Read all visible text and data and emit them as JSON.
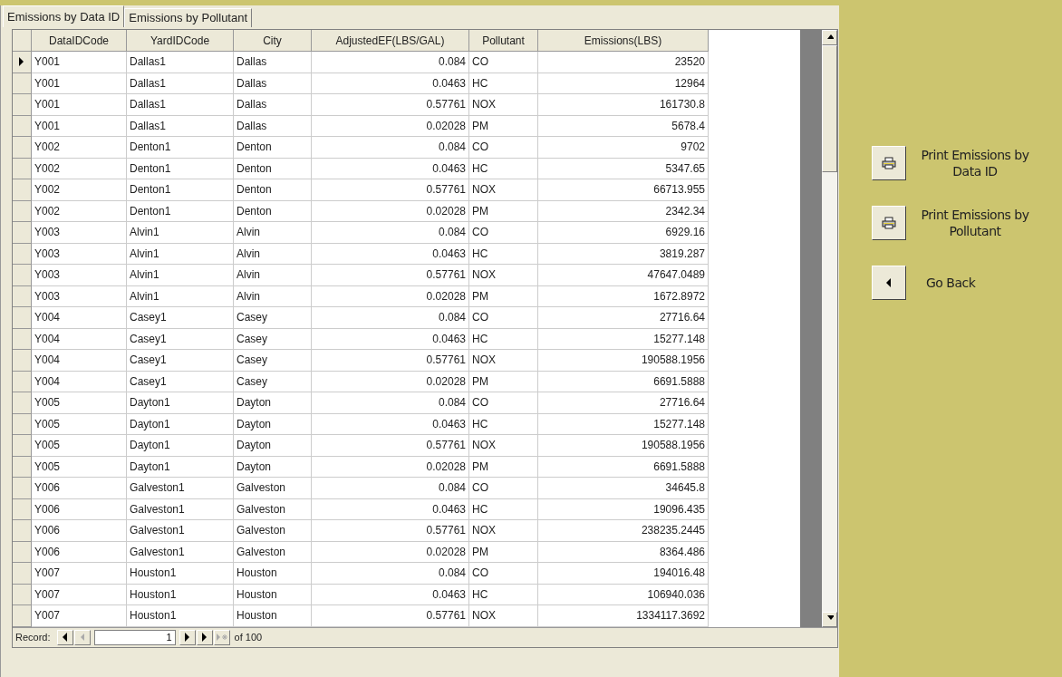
{
  "tabs": [
    {
      "label": "Emissions by Data ID",
      "selected": true
    },
    {
      "label": "Emissions by Pollutant",
      "selected": false
    }
  ],
  "table": {
    "columns": [
      "DataIDCode",
      "YardIDCode",
      "City",
      "AdjustedEF(LBS/GAL)",
      "Pollutant",
      "Emissions(LBS)"
    ],
    "rows": [
      {
        "current": true,
        "cells": [
          "Y001",
          "Dallas1",
          "Dallas",
          "0.084",
          "CO",
          "23520"
        ]
      },
      {
        "current": false,
        "cells": [
          "Y001",
          "Dallas1",
          "Dallas",
          "0.0463",
          "HC",
          "12964"
        ]
      },
      {
        "current": false,
        "cells": [
          "Y001",
          "Dallas1",
          "Dallas",
          "0.57761",
          "NOX",
          "161730.8"
        ]
      },
      {
        "current": false,
        "cells": [
          "Y001",
          "Dallas1",
          "Dallas",
          "0.02028",
          "PM",
          "5678.4"
        ]
      },
      {
        "current": false,
        "cells": [
          "Y002",
          "Denton1",
          "Denton",
          "0.084",
          "CO",
          "9702"
        ]
      },
      {
        "current": false,
        "cells": [
          "Y002",
          "Denton1",
          "Denton",
          "0.0463",
          "HC",
          "5347.65"
        ]
      },
      {
        "current": false,
        "cells": [
          "Y002",
          "Denton1",
          "Denton",
          "0.57761",
          "NOX",
          "66713.955"
        ]
      },
      {
        "current": false,
        "cells": [
          "Y002",
          "Denton1",
          "Denton",
          "0.02028",
          "PM",
          "2342.34"
        ]
      },
      {
        "current": false,
        "cells": [
          "Y003",
          "Alvin1",
          "Alvin",
          "0.084",
          "CO",
          "6929.16"
        ]
      },
      {
        "current": false,
        "cells": [
          "Y003",
          "Alvin1",
          "Alvin",
          "0.0463",
          "HC",
          "3819.287"
        ]
      },
      {
        "current": false,
        "cells": [
          "Y003",
          "Alvin1",
          "Alvin",
          "0.57761",
          "NOX",
          "47647.0489"
        ]
      },
      {
        "current": false,
        "cells": [
          "Y003",
          "Alvin1",
          "Alvin",
          "0.02028",
          "PM",
          "1672.8972"
        ]
      },
      {
        "current": false,
        "cells": [
          "Y004",
          "Casey1",
          "Casey",
          "0.084",
          "CO",
          "27716.64"
        ]
      },
      {
        "current": false,
        "cells": [
          "Y004",
          "Casey1",
          "Casey",
          "0.0463",
          "HC",
          "15277.148"
        ]
      },
      {
        "current": false,
        "cells": [
          "Y004",
          "Casey1",
          "Casey",
          "0.57761",
          "NOX",
          "190588.1956"
        ]
      },
      {
        "current": false,
        "cells": [
          "Y004",
          "Casey1",
          "Casey",
          "0.02028",
          "PM",
          "6691.5888"
        ]
      },
      {
        "current": false,
        "cells": [
          "Y005",
          "Dayton1",
          "Dayton",
          "0.084",
          "CO",
          "27716.64"
        ]
      },
      {
        "current": false,
        "cells": [
          "Y005",
          "Dayton1",
          "Dayton",
          "0.0463",
          "HC",
          "15277.148"
        ]
      },
      {
        "current": false,
        "cells": [
          "Y005",
          "Dayton1",
          "Dayton",
          "0.57761",
          "NOX",
          "190588.1956"
        ]
      },
      {
        "current": false,
        "cells": [
          "Y005",
          "Dayton1",
          "Dayton",
          "0.02028",
          "PM",
          "6691.5888"
        ]
      },
      {
        "current": false,
        "cells": [
          "Y006",
          "Galveston1",
          "Galveston",
          "0.084",
          "CO",
          "34645.8"
        ]
      },
      {
        "current": false,
        "cells": [
          "Y006",
          "Galveston1",
          "Galveston",
          "0.0463",
          "HC",
          "19096.435"
        ]
      },
      {
        "current": false,
        "cells": [
          "Y006",
          "Galveston1",
          "Galveston",
          "0.57761",
          "NOX",
          "238235.2445"
        ]
      },
      {
        "current": false,
        "cells": [
          "Y006",
          "Galveston1",
          "Galveston",
          "0.02028",
          "PM",
          "8364.486"
        ]
      },
      {
        "current": false,
        "cells": [
          "Y007",
          "Houston1",
          "Houston",
          "0.084",
          "CO",
          "194016.48"
        ]
      },
      {
        "current": false,
        "cells": [
          "Y007",
          "Houston1",
          "Houston",
          "0.0463",
          "HC",
          "106940.036"
        ]
      },
      {
        "current": false,
        "cells": [
          "Y007",
          "Houston1",
          "Houston",
          "0.57761",
          "NOX",
          "1334117.3692"
        ]
      }
    ]
  },
  "record_nav": {
    "label": "Record:",
    "value": "1",
    "total": "of 100",
    "new_disabled": true
  },
  "actions": [
    {
      "kind": "print",
      "label": "Print Emissions by Data ID"
    },
    {
      "kind": "print",
      "label": "Print Emissions by Pollutant"
    },
    {
      "kind": "back",
      "label": "Go Back"
    }
  ]
}
